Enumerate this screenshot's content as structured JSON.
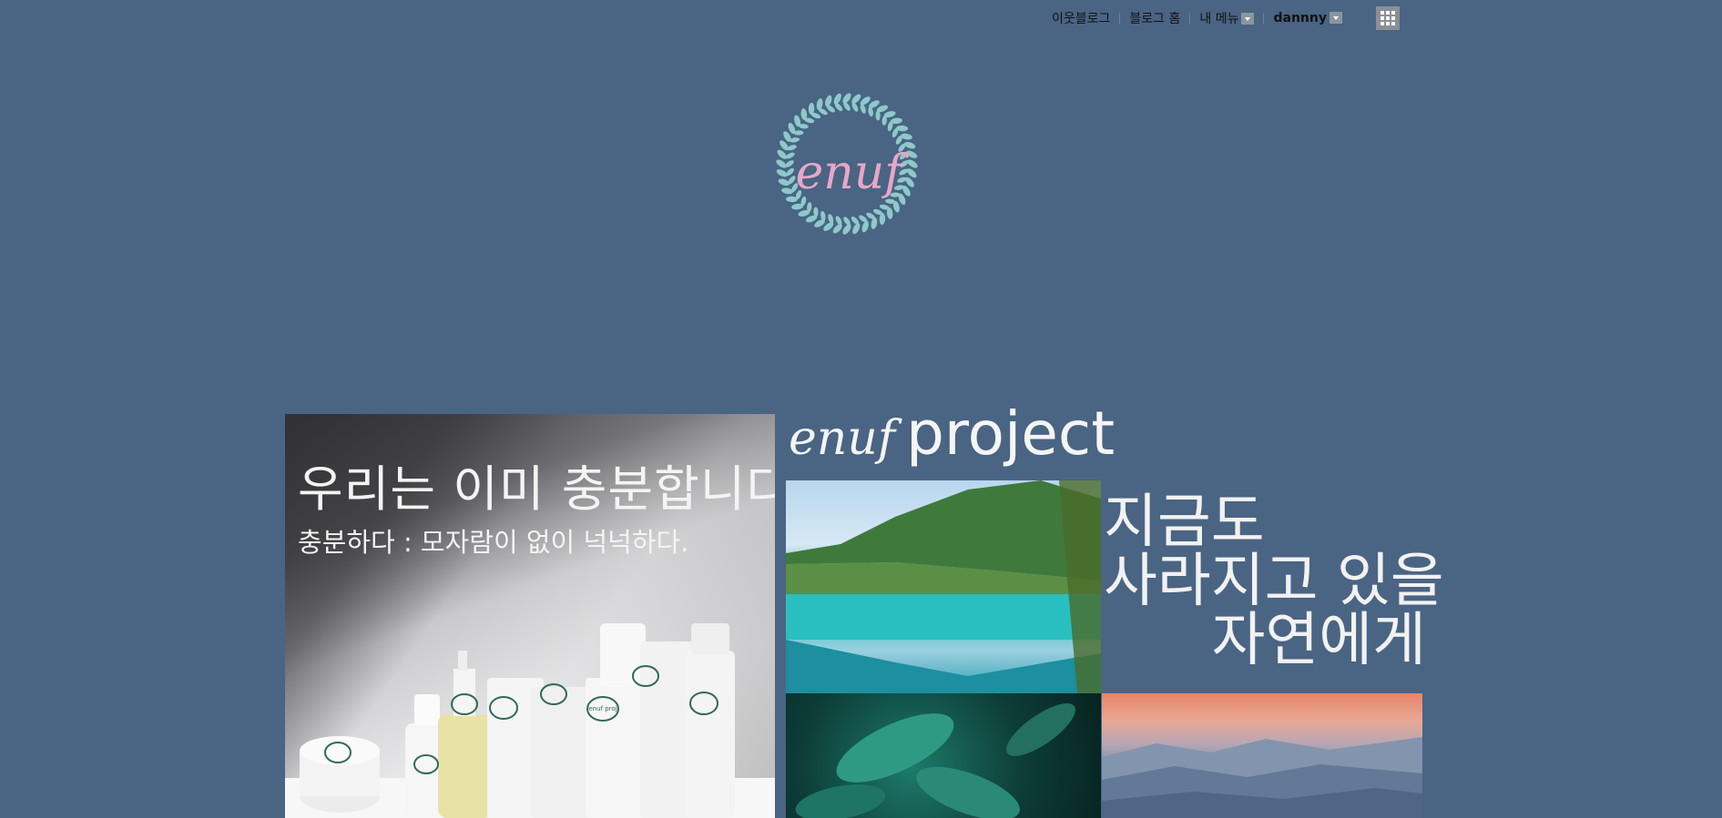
{
  "nav": {
    "neighbor_blog": "이웃블로그",
    "blog_home": "블로그 홈",
    "my_menu": "내 메뉴",
    "username": "dannny"
  },
  "icons": {
    "my_menu_dropdown": "chevron-down-icon",
    "user_dropdown": "chevron-down-icon",
    "apps": "grid-icon"
  },
  "logo": {
    "text": "enuf"
  },
  "left_banner": {
    "title": "우리는 이미 충분합니다.",
    "subtitle": "충분하다 : 모자람이 없이 넉넉하다.",
    "product_label": "enuf proj"
  },
  "project_banner": {
    "brand": "enuf",
    "word": "project",
    "line1": "지금도",
    "line2": "사라지고 있을",
    "line3": "자연에게"
  },
  "colors": {
    "background": "#4a6483",
    "logo_wreath": "#8ec9c9",
    "logo_text": "#e7a7c8"
  }
}
